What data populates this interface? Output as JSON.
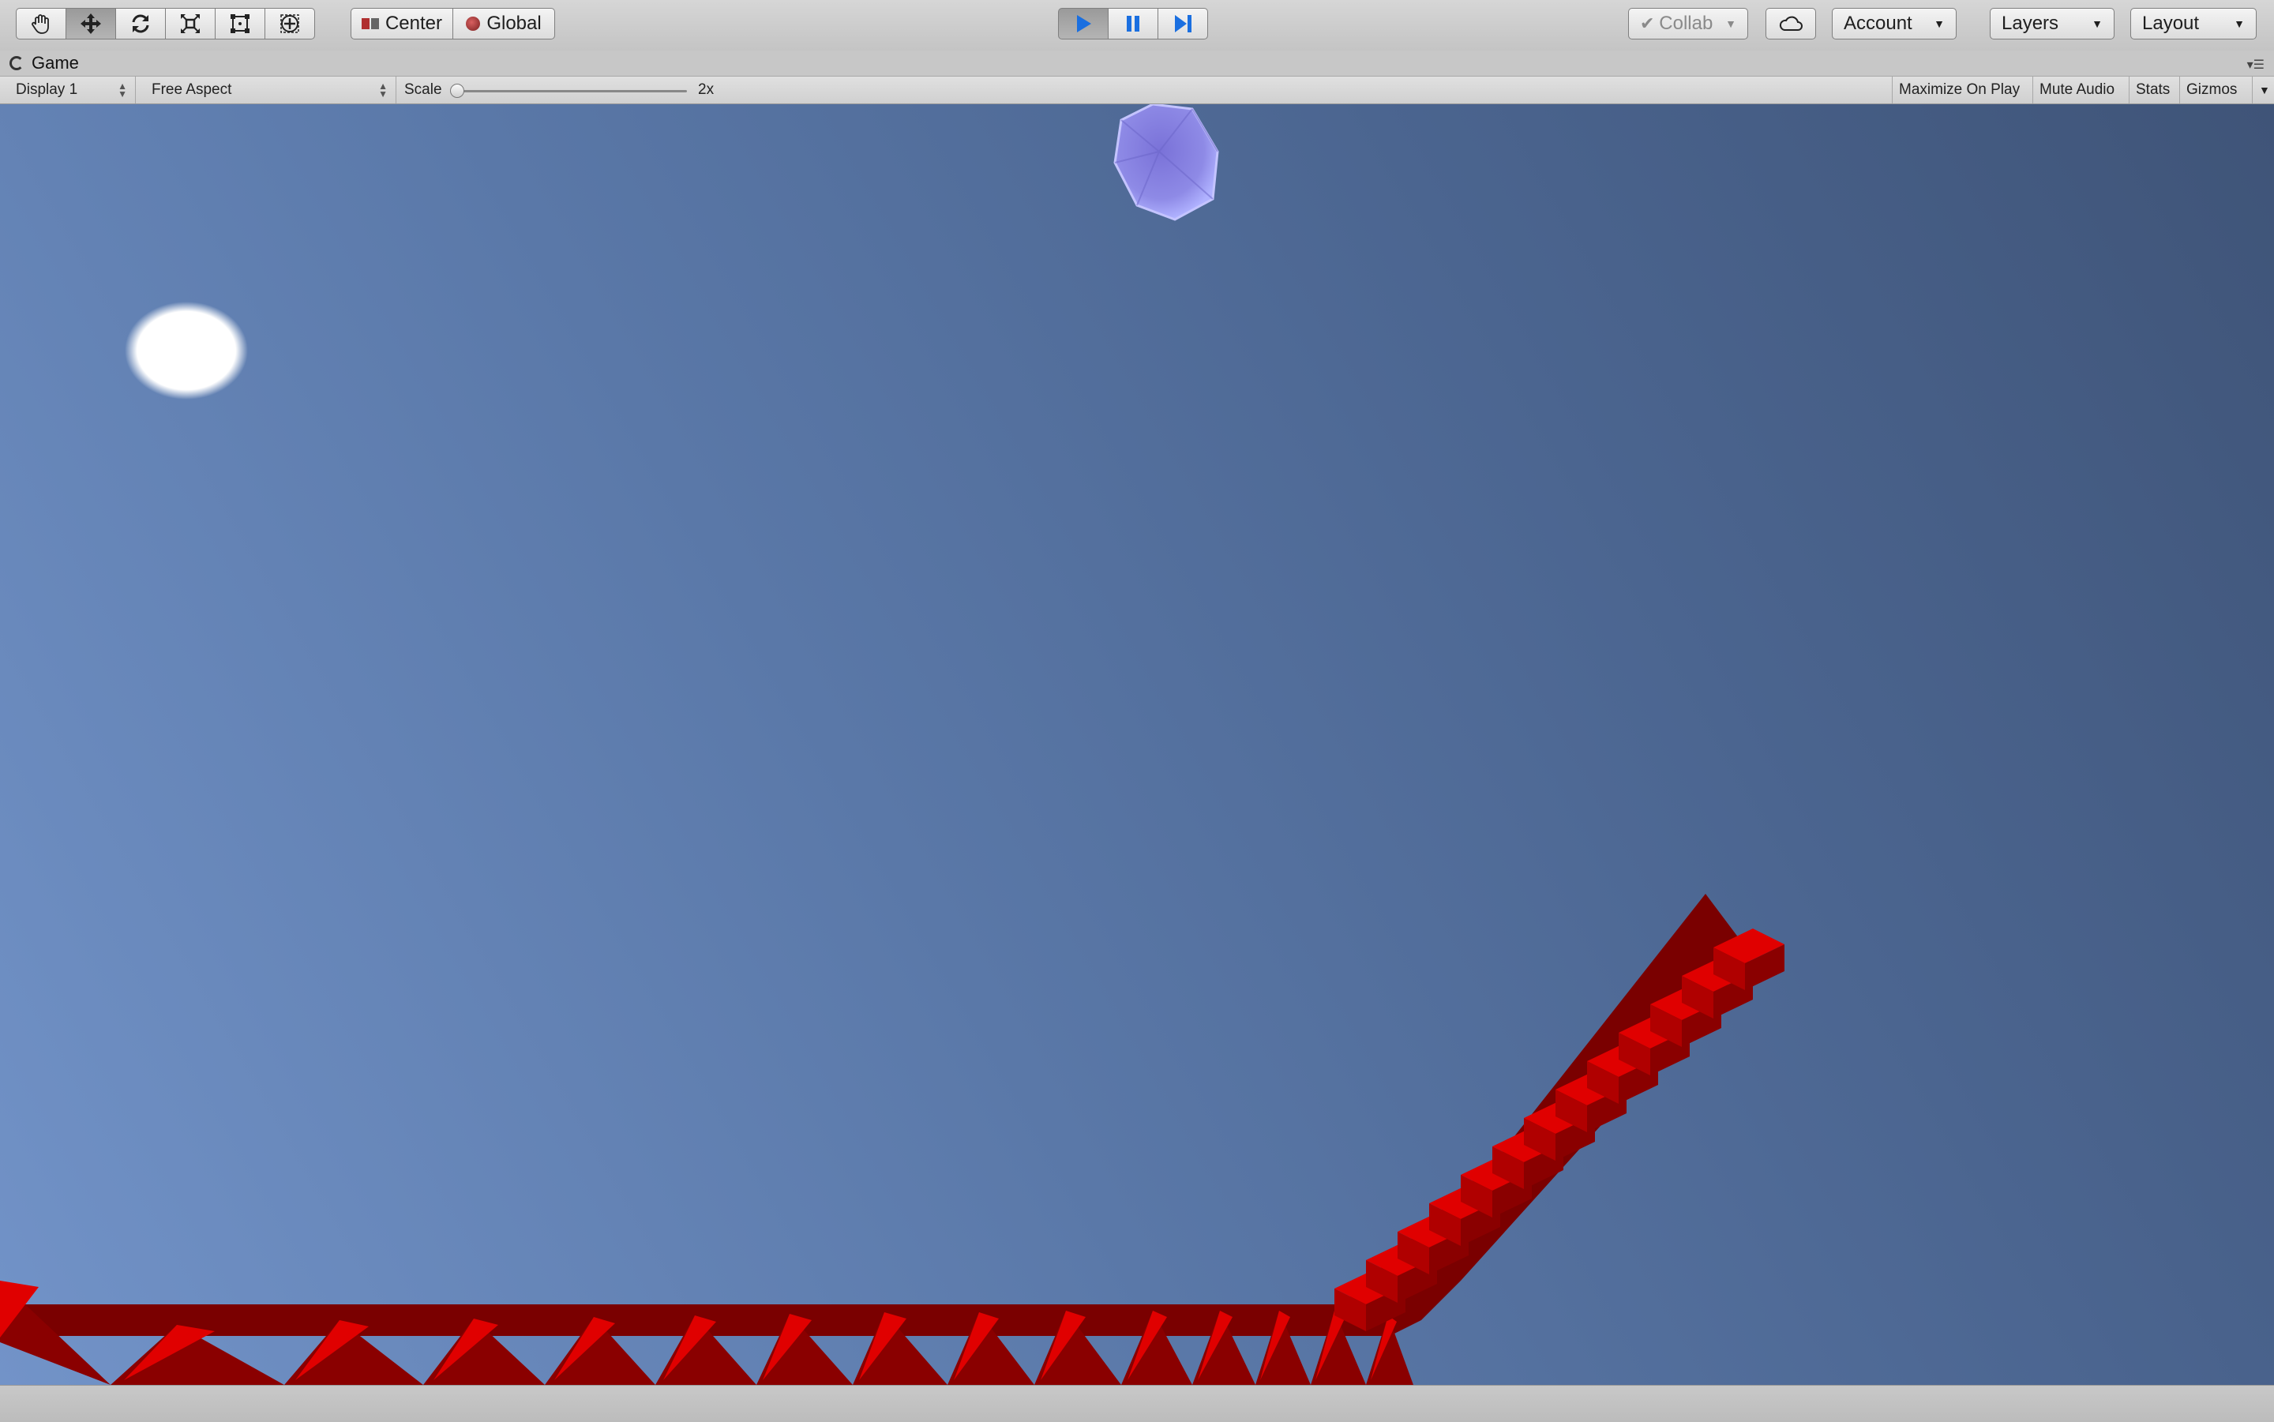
{
  "toolbar": {
    "tools": [
      {
        "icon": "hand-icon"
      },
      {
        "icon": "move-icon"
      },
      {
        "icon": "rotate-icon"
      },
      {
        "icon": "scale-icon"
      },
      {
        "icon": "rect-tool-icon"
      },
      {
        "icon": "transform-icon"
      }
    ],
    "pivot_label": "Center",
    "space_label": "Global",
    "play_controls": [
      {
        "icon": "play-icon",
        "active": true
      },
      {
        "icon": "pause-icon",
        "active": false
      },
      {
        "icon": "step-icon",
        "active": false
      }
    ],
    "collab_label": "Collab",
    "account_label": "Account",
    "layers_label": "Layers",
    "layout_label": "Layout",
    "accent_color": "#1a6fe0"
  },
  "tab": {
    "title": "Game"
  },
  "game_view": {
    "display": "Display 1",
    "aspect": "Free Aspect",
    "scale_label": "Scale",
    "scale_value": "2x",
    "toggles": [
      "Maximize On Play",
      "Mute Audio",
      "Stats",
      "Gizmos"
    ]
  },
  "scene": {
    "sky_color": "#5a78a8",
    "sun_color": "#ffffff",
    "ball_color": "#8a88e0",
    "track_color": "#cc0000"
  }
}
